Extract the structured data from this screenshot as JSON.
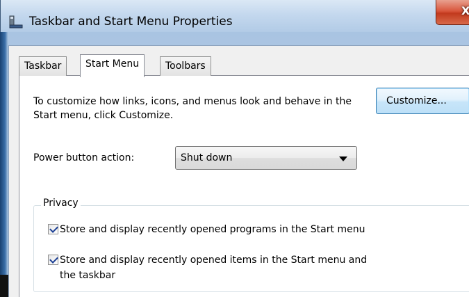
{
  "window": {
    "title": "Taskbar and Start Menu Properties",
    "close_label": "X"
  },
  "tabs": [
    {
      "label": "Taskbar",
      "active": false
    },
    {
      "label": "Start Menu",
      "active": true
    },
    {
      "label": "Toolbars",
      "active": false
    }
  ],
  "start_menu": {
    "description": "To customize how links, icons, and menus look and behave in the Start menu, click Customize.",
    "customize_label": "Customize...",
    "power_label": "Power button action:",
    "power_value": "Shut down"
  },
  "privacy": {
    "legend": "Privacy",
    "items": [
      {
        "label": "Store and display recently opened programs in the Start menu",
        "checked": true
      },
      {
        "label": "Store and display recently opened items in the Start menu and",
        "label_line2": "the taskbar",
        "checked": true
      }
    ]
  },
  "colors": {
    "accent_blue": "#3c7fb1",
    "close_red": "#c23a1e",
    "check_blue": "#1c3f94"
  }
}
